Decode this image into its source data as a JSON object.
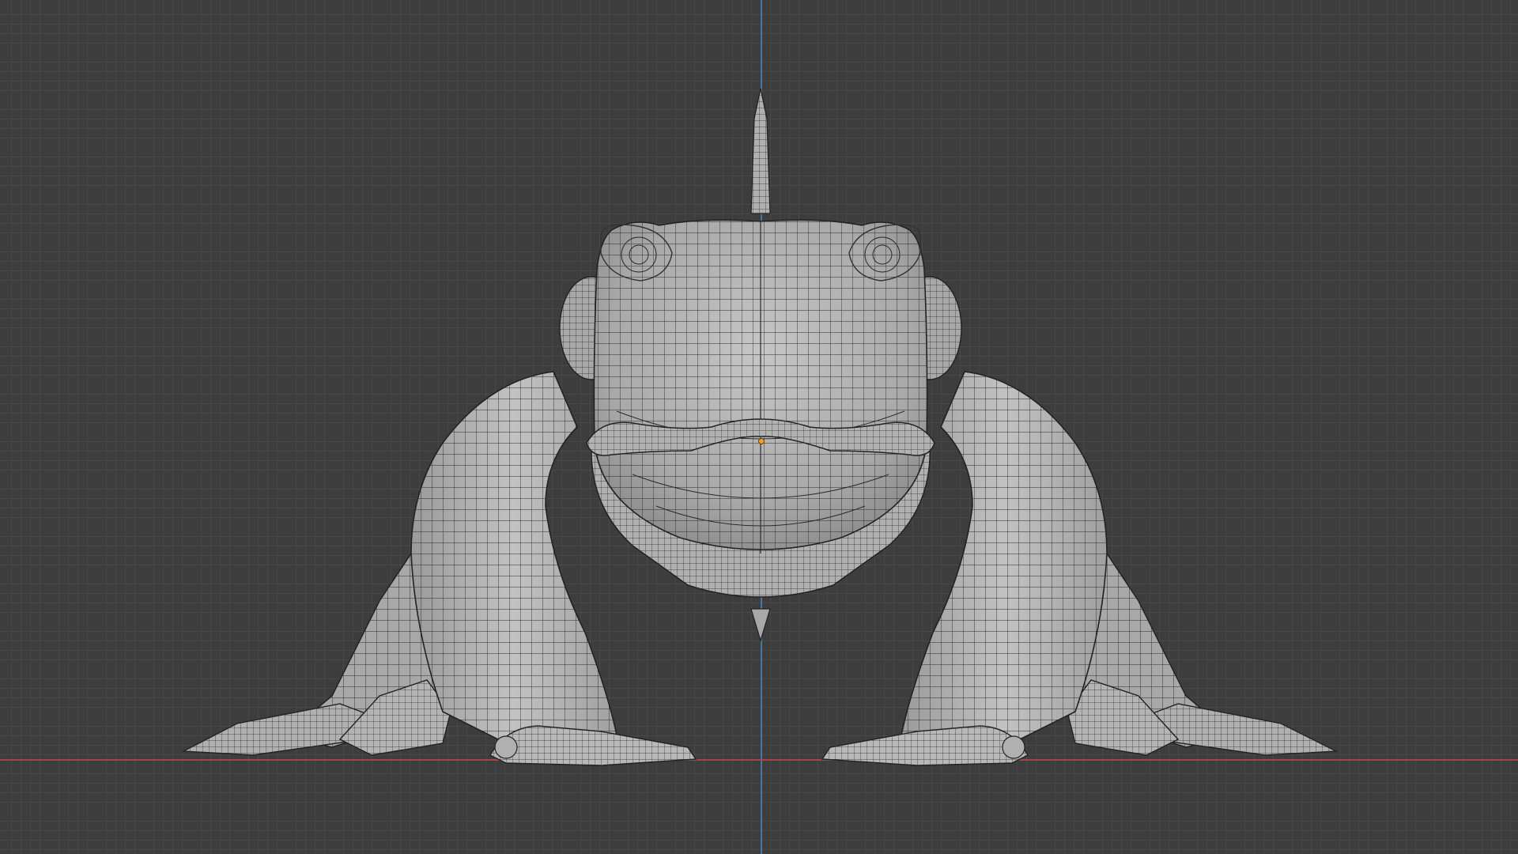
{
  "viewport": {
    "view": "front-orthographic",
    "colors": {
      "background": "#3d3d3d",
      "grid_minor": "#474747",
      "grid_major": "#2f2f2f",
      "axis_z": "#4a7fb8",
      "axis_x": "#b8434f",
      "mesh_fill": "#b4b4b4",
      "mesh_wire": "#2a2a2a",
      "origin": "#f0a030"
    }
  },
  "scene": {
    "object": "frog-creature-mesh",
    "shading": "solid-with-wireframe"
  }
}
